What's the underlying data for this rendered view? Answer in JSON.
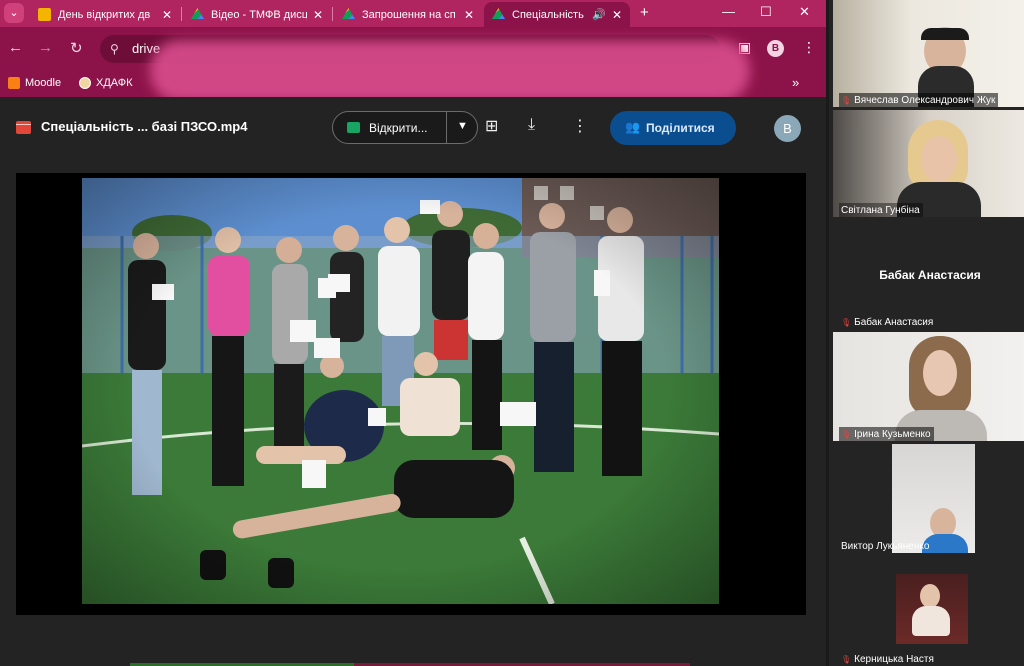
{
  "browser": {
    "tabs": [
      {
        "label": "День відкритих дв",
        "active": false,
        "favicon_color": "#f4b400"
      },
      {
        "label": "Відео - ТМФВ дисц",
        "active": false,
        "favicon_color": "#4285f4"
      },
      {
        "label": "Запрошення на сп",
        "active": false,
        "favicon_color": "#4285f4"
      },
      {
        "label": "Спеціальність",
        "active": true,
        "favicon_color": "#4285f4"
      }
    ],
    "omnibox_text": "drive",
    "bookmarks": [
      {
        "label": "Moodle",
        "icon": "moodle-icon"
      },
      {
        "label": "ХДАФК",
        "icon": "hdafk-icon"
      }
    ],
    "profile_initial": "B"
  },
  "viewer": {
    "file_title": "Спеціальність ... базі ПЗСО.mp4",
    "open_with_label": "Відкрити...",
    "share_label": "Поділитися",
    "user_initial": "B"
  },
  "participants": [
    {
      "name": "Вячеслав Олександрович Жук",
      "muted": true,
      "video": true
    },
    {
      "name": "Світлана Гунбіна",
      "muted": false,
      "video": true
    },
    {
      "name": "Бабак Анастасия",
      "muted": true,
      "video": false,
      "center_label": "Бабак Анастасия"
    },
    {
      "name": "Ірина Кузьменко",
      "muted": true,
      "video": true
    },
    {
      "name": "Виктор Лукьяненко",
      "muted": false,
      "video": true
    },
    {
      "name": "Керницька Настя",
      "muted": true,
      "video": true
    }
  ],
  "colors": {
    "tab_strip": "#b0245f",
    "toolbar": "#8c1349",
    "share_button": "#0b4e8f",
    "viewer_bg": "#232323"
  }
}
